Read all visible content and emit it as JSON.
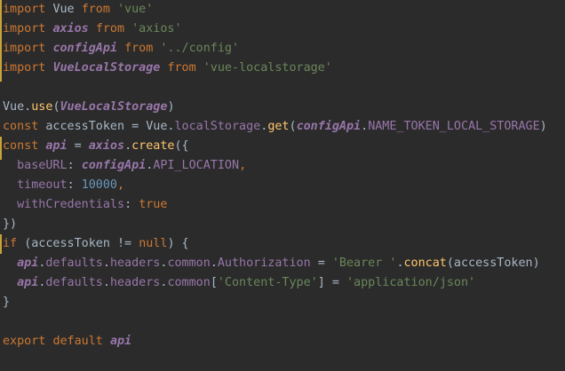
{
  "editor": {
    "background": "#2b2b2b",
    "gutter_marker_color": "#c9a33a",
    "lines": [
      {
        "tokens": [
          {
            "t": "import ",
            "c": "kw"
          },
          {
            "t": "Vue ",
            "c": "plain"
          },
          {
            "t": "from ",
            "c": "kw"
          },
          {
            "t": "'vue'",
            "c": "str"
          }
        ]
      },
      {
        "tokens": [
          {
            "t": "import ",
            "c": "kw"
          },
          {
            "t": "axios ",
            "c": "prop italic bold"
          },
          {
            "t": "from ",
            "c": "kw"
          },
          {
            "t": "'axios'",
            "c": "str"
          }
        ]
      },
      {
        "tokens": [
          {
            "t": "import ",
            "c": "kw"
          },
          {
            "t": "configApi ",
            "c": "prop italic bold"
          },
          {
            "t": "from ",
            "c": "kw"
          },
          {
            "t": "'../config'",
            "c": "str"
          }
        ]
      },
      {
        "tokens": [
          {
            "t": "import ",
            "c": "kw"
          },
          {
            "t": "VueLocalStorage ",
            "c": "prop italic bold"
          },
          {
            "t": "from ",
            "c": "kw"
          },
          {
            "t": "'vue-localstorage'",
            "c": "str"
          }
        ]
      },
      {
        "tokens": []
      },
      {
        "tokens": [
          {
            "t": "Vue.",
            "c": "plain"
          },
          {
            "t": "use",
            "c": "fn"
          },
          {
            "t": "(",
            "c": "plain"
          },
          {
            "t": "VueLocalStorage",
            "c": "prop italic bold"
          },
          {
            "t": ")",
            "c": "plain"
          }
        ]
      },
      {
        "tokens": [
          {
            "t": "const ",
            "c": "kw"
          },
          {
            "t": "accessToken = Vue.",
            "c": "plain"
          },
          {
            "t": "localStorage",
            "c": "prop"
          },
          {
            "t": ".",
            "c": "plain"
          },
          {
            "t": "get",
            "c": "fn"
          },
          {
            "t": "(",
            "c": "plain"
          },
          {
            "t": "configApi",
            "c": "prop italic bold"
          },
          {
            "t": ".",
            "c": "plain"
          },
          {
            "t": "NAME_TOKEN_LOCAL_STORAGE",
            "c": "prop"
          },
          {
            "t": ")",
            "c": "plain"
          }
        ]
      },
      {
        "tokens": [
          {
            "t": "const ",
            "c": "kw"
          },
          {
            "t": "api",
            "c": "prop italic bold"
          },
          {
            "t": " = ",
            "c": "plain"
          },
          {
            "t": "axios",
            "c": "prop italic bold"
          },
          {
            "t": ".",
            "c": "plain"
          },
          {
            "t": "create",
            "c": "fn"
          },
          {
            "t": "({",
            "c": "plain"
          }
        ]
      },
      {
        "tokens": [
          {
            "t": "  baseURL",
            "c": "prop"
          },
          {
            "t": ": ",
            "c": "plain"
          },
          {
            "t": "configApi",
            "c": "prop italic bold"
          },
          {
            "t": ".",
            "c": "plain"
          },
          {
            "t": "API_LOCATION",
            "c": "prop"
          },
          {
            "t": ",",
            "c": "kw"
          }
        ]
      },
      {
        "tokens": [
          {
            "t": "  timeout",
            "c": "prop"
          },
          {
            "t": ": ",
            "c": "plain"
          },
          {
            "t": "10000",
            "c": "num"
          },
          {
            "t": ",",
            "c": "kw"
          }
        ]
      },
      {
        "tokens": [
          {
            "t": "  withCredentials",
            "c": "prop"
          },
          {
            "t": ": ",
            "c": "plain"
          },
          {
            "t": "true",
            "c": "kw"
          }
        ]
      },
      {
        "tokens": [
          {
            "t": "})",
            "c": "plain"
          }
        ]
      },
      {
        "tokens": [
          {
            "t": "if ",
            "c": "kw"
          },
          {
            "t": "(accessToken != ",
            "c": "plain"
          },
          {
            "t": "null",
            "c": "kw"
          },
          {
            "t": ") {",
            "c": "plain"
          }
        ]
      },
      {
        "tokens": [
          {
            "t": "  ",
            "c": "plain"
          },
          {
            "t": "api",
            "c": "prop italic bold"
          },
          {
            "t": ".",
            "c": "plain"
          },
          {
            "t": "defaults",
            "c": "prop"
          },
          {
            "t": ".",
            "c": "plain"
          },
          {
            "t": "headers",
            "c": "prop"
          },
          {
            "t": ".",
            "c": "plain"
          },
          {
            "t": "common",
            "c": "prop"
          },
          {
            "t": ".",
            "c": "plain"
          },
          {
            "t": "Authorization",
            "c": "prop"
          },
          {
            "t": " = ",
            "c": "plain"
          },
          {
            "t": "'Bearer '",
            "c": "str"
          },
          {
            "t": ".",
            "c": "plain"
          },
          {
            "t": "concat",
            "c": "fn"
          },
          {
            "t": "(accessToken)",
            "c": "plain"
          }
        ]
      },
      {
        "tokens": [
          {
            "t": "  ",
            "c": "plain"
          },
          {
            "t": "api",
            "c": "prop italic bold"
          },
          {
            "t": ".",
            "c": "plain"
          },
          {
            "t": "defaults",
            "c": "prop"
          },
          {
            "t": ".",
            "c": "plain"
          },
          {
            "t": "headers",
            "c": "prop"
          },
          {
            "t": ".",
            "c": "plain"
          },
          {
            "t": "common",
            "c": "prop"
          },
          {
            "t": "[",
            "c": "plain"
          },
          {
            "t": "'Content-Type'",
            "c": "str"
          },
          {
            "t": "] = ",
            "c": "plain"
          },
          {
            "t": "'application/json'",
            "c": "str"
          }
        ]
      },
      {
        "tokens": [
          {
            "t": "}",
            "c": "plain"
          }
        ]
      },
      {
        "tokens": []
      },
      {
        "tokens": [
          {
            "t": "export ",
            "c": "kw"
          },
          {
            "t": "default ",
            "c": "kw"
          },
          {
            "t": "api",
            "c": "prop italic bold"
          }
        ]
      }
    ]
  }
}
